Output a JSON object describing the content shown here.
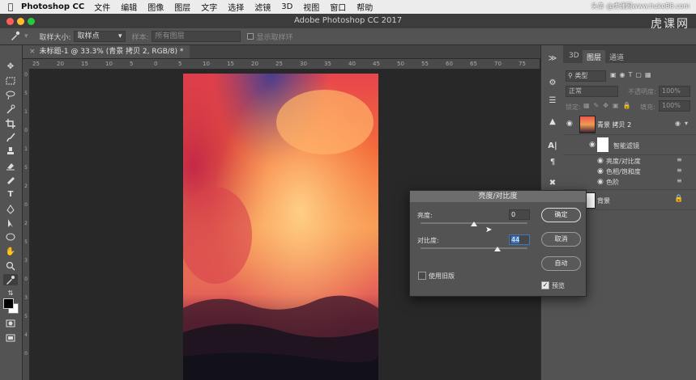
{
  "menubar": {
    "app": "Photoshop CC",
    "menus": [
      "文件",
      "编辑",
      "图像",
      "图层",
      "文字",
      "选择",
      "滤镜",
      "3D",
      "视图",
      "窗口",
      "帮助"
    ],
    "watermark": "头条 @虎课网www.huke88.com"
  },
  "window": {
    "title": "Adobe Photoshop CC 2017",
    "brand": "虎课网"
  },
  "options": {
    "sample_size_label": "取样大小:",
    "sample_size_value": "取样点",
    "sample_label": "样本:",
    "sample_value": "所有图层",
    "show_ring": "显示取样环"
  },
  "document": {
    "tab_title": "未标题-1 @ 33.3% (青景 拷贝 2, RGB/8) *"
  },
  "ruler": {
    "h_ticks": [
      "25",
      "20",
      "15",
      "10",
      "5",
      "0",
      "5",
      "10",
      "15",
      "20",
      "25",
      "30",
      "35",
      "40",
      "45",
      "50",
      "55",
      "60",
      "65",
      "70",
      "75"
    ],
    "v_ticks": [
      "0",
      "5",
      "1",
      "0",
      "1",
      "5",
      "2",
      "0",
      "2",
      "5",
      "3",
      "0",
      "3",
      "5",
      "4",
      "0"
    ]
  },
  "panel": {
    "tabs": [
      "3D",
      "图层",
      "通道"
    ],
    "filter_kind": "类型",
    "blend_mode": "正常",
    "opacity_label": "不透明度:",
    "opacity_value": "100%",
    "lock_label": "锁定:",
    "fill_label": "填充:",
    "fill_value": "100%",
    "layers": [
      {
        "name": "青景 拷贝 2"
      },
      {
        "name": "智能滤镜"
      },
      {
        "name": "亮度/对比度"
      },
      {
        "name": "色相/饱和度"
      },
      {
        "name": "色阶"
      },
      {
        "name": "背景"
      }
    ]
  },
  "dialog": {
    "title": "亮度/对比度",
    "brightness_label": "亮度:",
    "brightness_value": "0",
    "contrast_label": "对比度:",
    "contrast_value": "44",
    "legacy_label": "使用旧版",
    "preview_label": "预览",
    "ok": "确定",
    "cancel": "取消",
    "auto": "自动",
    "brightness_level": 0.5,
    "contrast_level": 0.72
  },
  "colors": {
    "accent": "#3b78c6",
    "panel": "#535353",
    "canvas": "#282828"
  }
}
